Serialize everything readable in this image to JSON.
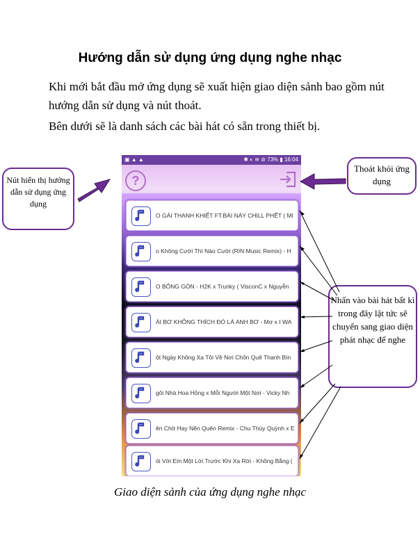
{
  "document": {
    "title": "Hướng dẫn sử dụng ứng dụng nghe nhạc",
    "paragraph1": "Khi mới bắt đầu mở ứng dụng sẽ xuất hiện giao diện sảnh bao gồm nút hướng dẫn sử dụng và nút thoát.",
    "paragraph2": "Bên dưới sẽ là danh sách các bài hát có sẵn trong thiết bị.",
    "caption": "Giao diện sảnh của ứng dụng nghe nhạc"
  },
  "callouts": {
    "help": "Nút hiển thị hướng dẫn sử dụng ứng dụng",
    "exit": "Thoát khỏi ứng dụng",
    "song": "Nhấn vào bài hát bất kì trong đây lật tức sẽ chuyển sang giao diện phát nhạc để nghe"
  },
  "phone": {
    "status_left": "▣ ▲ ▲",
    "status_right": "✱ ◐ ≋ ⊘ 73% ▮ 16:04",
    "help_symbol": "?",
    "songs": [
      "O GÁI THANH KHIẾT FT.BÀI NÀY CHILL PHẾT ( MI",
      "o Không Cười Thì Nào Cười (RIN Music Remix) - H",
      "O BÔNG GÒN - H2K x Trunky ( VisconC x Nguyễn",
      "ÀI BƠ KHÔNG THÍCH ĐÓ LÀ ANH BƠ - Mơ x I WA",
      "ột Ngày Không Xa Tôi Về Nơi Chốn Quê Thanh Bìn",
      "gôi Nhà Hoa Hồng x Mỗi Người Một Nơi - Vicky Nh",
      "ên Chờ Hay Nên Quên Remix - Chu Thúy Quỳnh x E",
      "ói Với Em Một Lời Trước Khi Xa Rời - Không Bằng ("
    ]
  },
  "colors": {
    "accent_purple": "#6b2c91",
    "statusbar": "#6b3fa0",
    "icon_blue": "#4a56c0"
  },
  "icons": [
    "help-icon",
    "exit-icon",
    "music-note-icon",
    "arrow-icon"
  ]
}
